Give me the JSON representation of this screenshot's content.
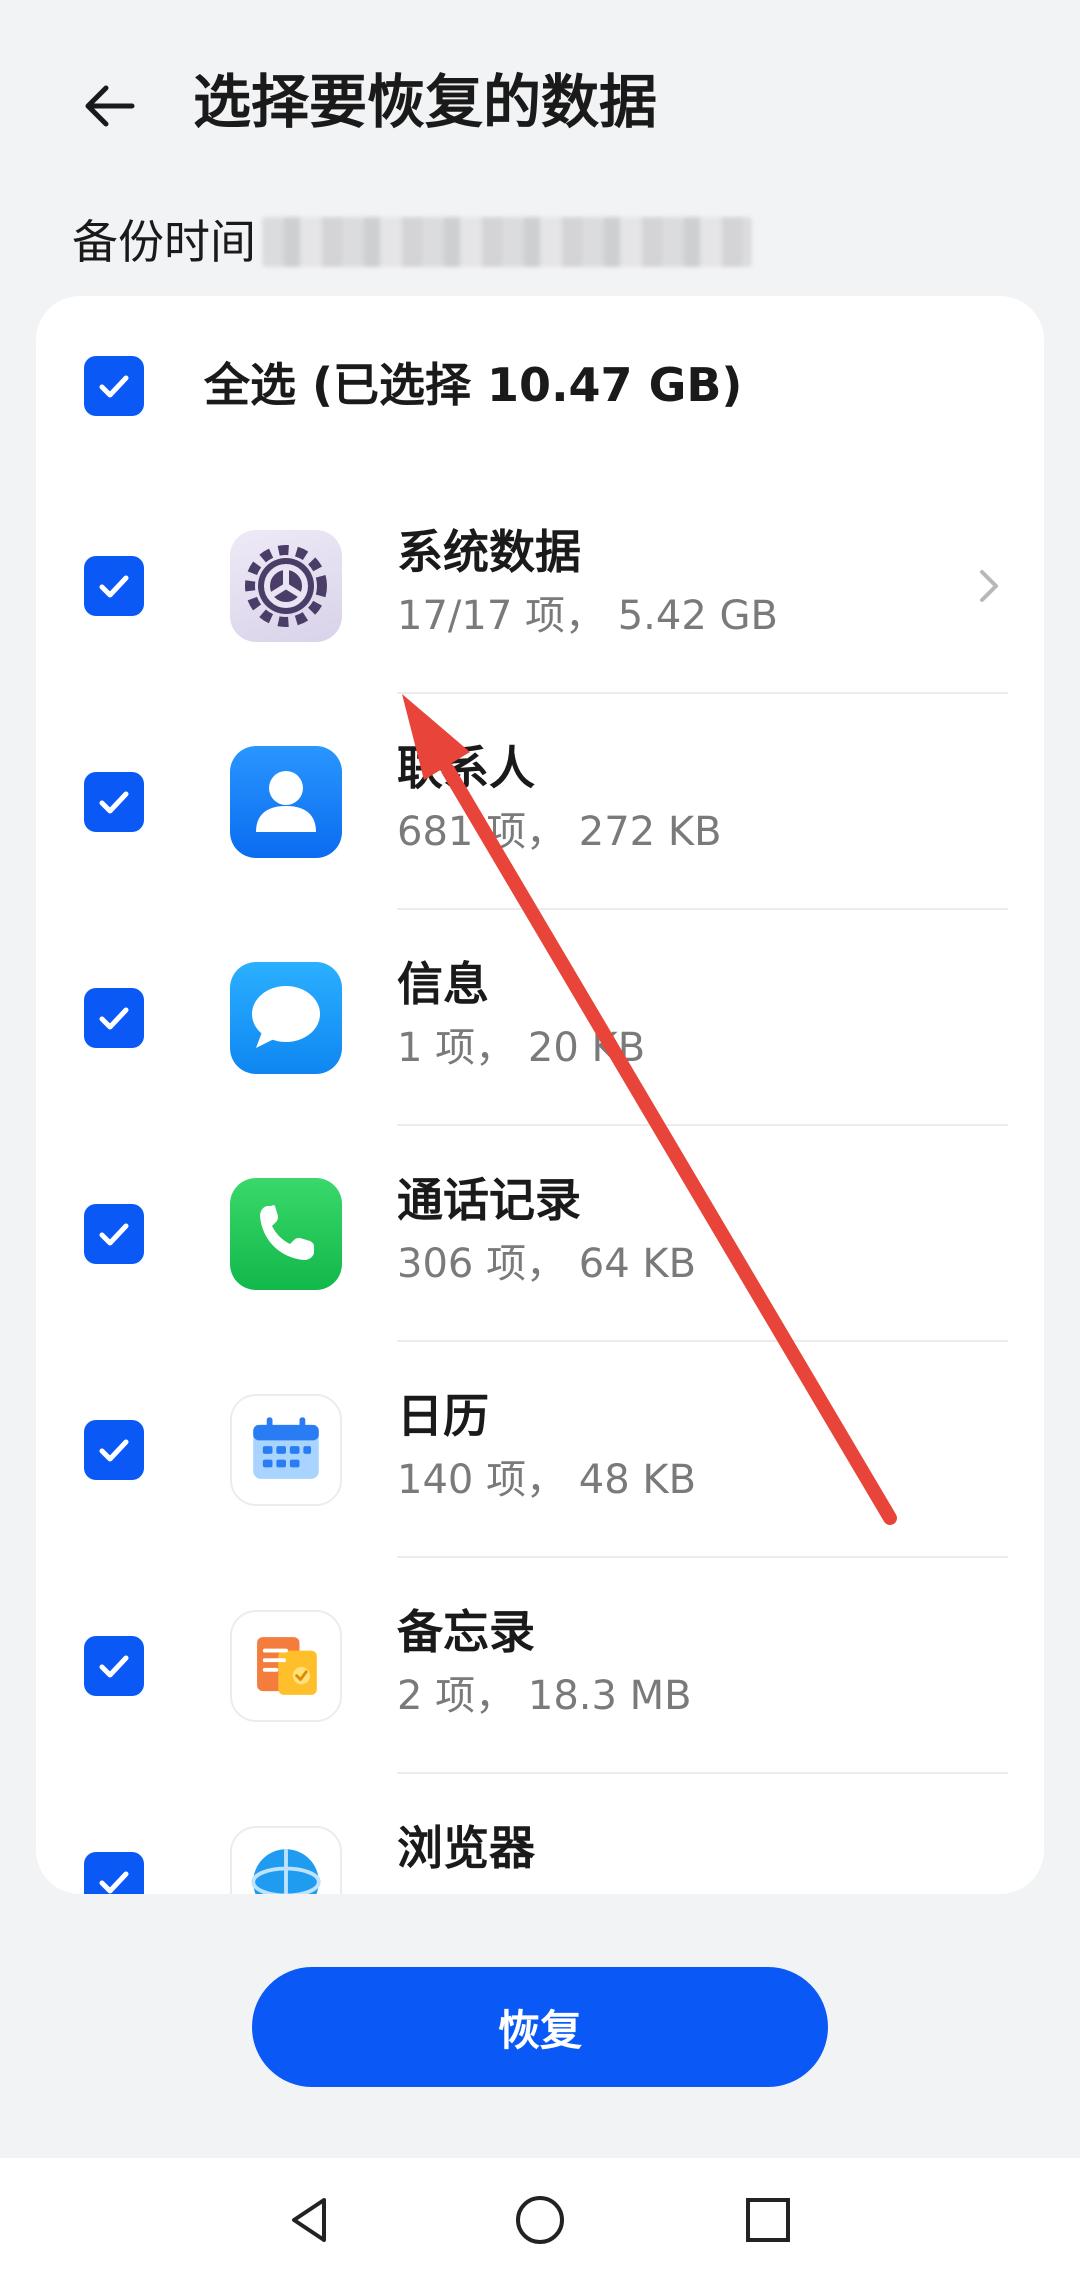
{
  "header": {
    "title": "选择要恢复的数据",
    "back_icon": "arrow-left-icon"
  },
  "backup_time": {
    "label": "备份时间"
  },
  "select_all": {
    "label": "全选 (已选择 10.47 GB)",
    "checked": true
  },
  "items": [
    {
      "name": "系统数据",
      "meta": "17/17 项， 5.42 GB",
      "icon": "settings-gear-icon",
      "checked": true,
      "has_chevron": true
    },
    {
      "name": "联系人",
      "meta": "681 项， 272 KB",
      "icon": "contacts-icon",
      "checked": true
    },
    {
      "name": "信息",
      "meta": "1 项， 20 KB",
      "icon": "messages-icon",
      "checked": true
    },
    {
      "name": "通话记录",
      "meta": "306 项， 64 KB",
      "icon": "phone-icon",
      "checked": true
    },
    {
      "name": "日历",
      "meta": "140 项， 48 KB",
      "icon": "calendar-icon",
      "checked": true
    },
    {
      "name": "备忘录",
      "meta": "2 项， 18.3 MB",
      "icon": "notes-icon",
      "checked": true
    },
    {
      "name": "浏览器",
      "meta": "",
      "icon": "browser-icon",
      "checked": true
    }
  ],
  "restore_button": {
    "label": "恢复"
  },
  "navbar": {
    "back": "nav-back-icon",
    "home": "nav-home-icon",
    "recents": "nav-recents-icon"
  },
  "colors": {
    "accent": "#0a59f7",
    "background": "#f1f3f5",
    "annotation_arrow": "#e8443a"
  }
}
